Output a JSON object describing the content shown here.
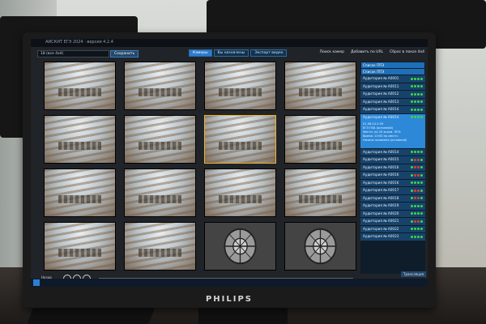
{
  "scene": {
    "monitor_brand": "PHILIPS"
  },
  "app": {
    "title": "АИСКИТ ЕГЭ 2024 · версия 4.2.4",
    "tabs": [
      {
        "label": "Камеры",
        "active": true
      },
      {
        "label": "Вы назначены",
        "active": false
      },
      {
        "label": "Экспорт видео",
        "active": false
      }
    ],
    "camera_select": "18 (все 4x4)",
    "save_label": "Сохранить",
    "toolbar_links": [
      "Поиск камер",
      "Добавить по URL",
      "Сброс в показ 4x4"
    ]
  },
  "grid": {
    "cells": [
      "cam",
      "cam",
      "cam",
      "cam",
      "cam",
      "cam",
      "cam",
      "cam",
      "cam",
      "cam",
      "cam",
      "cam",
      "cam",
      "cam",
      "test",
      "test"
    ],
    "selected_index": 6
  },
  "sidebar": {
    "headers": [
      "Список ППЭ",
      "Список ППЭ"
    ],
    "rooms": [
      {
        "label": "Аудитория № А0001",
        "status": "gggg"
      },
      {
        "label": "Аудитория № А0011",
        "status": "gggg"
      },
      {
        "label": "Аудитория № А0012",
        "status": "gggg"
      },
      {
        "label": "Аудитория № А0013",
        "status": "gggg"
      },
      {
        "label": "Аудитория № А0014",
        "status": "gggg"
      },
      {
        "label": "Аудитория № А0014",
        "status": "gggg",
        "active": true,
        "details": [
          "01.06.24.3.59",
          "ЕГЭ ГИА (основной)",
          "Место: на 20 экзам. ППЭ",
          "Время: 10:00 по местн.",
          "Начало экзамена (основной)"
        ]
      },
      {
        "label": "Аудитория № А0014",
        "status": "gggg"
      },
      {
        "label": "Аудитория № А0015",
        "status": "grrg"
      },
      {
        "label": "Аудитория № А0016",
        "status": "grrg"
      },
      {
        "label": "Аудитория № А0016",
        "status": "grrg"
      },
      {
        "label": "Аудитория № А0016",
        "status": "gggg"
      },
      {
        "label": "Аудитория № А0017",
        "status": "grrg"
      },
      {
        "label": "Аудитория № А0018",
        "status": "grrg"
      },
      {
        "label": "Аудитория № А0019",
        "status": "gggg"
      },
      {
        "label": "Аудитория № А0020",
        "status": "gggg"
      },
      {
        "label": "Аудитория № А0021",
        "status": "grrg"
      },
      {
        "label": "Аудитория № А0022",
        "status": "gggg"
      },
      {
        "label": "Аудитория № А0023",
        "status": "gggg"
      }
    ]
  },
  "player": {
    "back_label": "Назад",
    "translate_label": "Трансляция"
  },
  "colors": {
    "accent": "#2d88d8",
    "selected_border": "#f0b12c",
    "status_ok": "#3fd44a",
    "status_bad": "#e23b3b"
  }
}
